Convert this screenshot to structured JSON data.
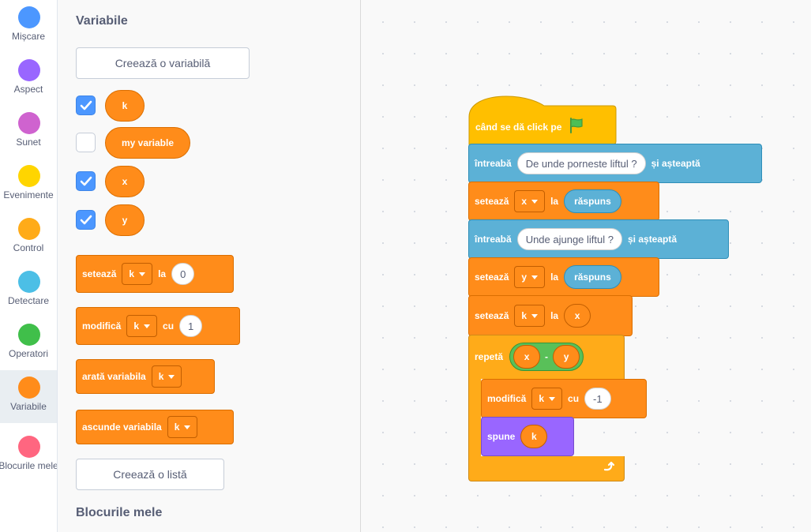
{
  "categories": [
    {
      "label": "Mișcare",
      "color": "#4c97ff",
      "icon": "motion-category-icon"
    },
    {
      "label": "Aspect",
      "color": "#9966ff",
      "icon": "looks-category-icon"
    },
    {
      "label": "Sunet",
      "color": "#cf63cf",
      "icon": "sound-category-icon"
    },
    {
      "label": "Evenimente",
      "color": "#ffd500",
      "icon": "events-category-icon"
    },
    {
      "label": "Control",
      "color": "#ffab19",
      "icon": "control-category-icon"
    },
    {
      "label": "Detectare",
      "color": "#4cbfe6",
      "icon": "sensing-category-icon"
    },
    {
      "label": "Operatori",
      "color": "#40bf4a",
      "icon": "operators-category-icon"
    },
    {
      "label": "Variabile",
      "color": "#ff8c1a",
      "icon": "variables-category-icon",
      "active": true
    },
    {
      "label": "Blocurile mele",
      "color": "#ff6680",
      "icon": "my-blocks-category-icon"
    }
  ],
  "palette": {
    "heading": "Variabile",
    "make_variable": "Creează o variabilă",
    "variables": [
      {
        "name": "k",
        "checked": true
      },
      {
        "name": "my variable",
        "checked": false
      },
      {
        "name": "x",
        "checked": true
      },
      {
        "name": "y",
        "checked": true
      }
    ],
    "set_block": {
      "label": "setează",
      "var": "k",
      "to": "la",
      "value": "0"
    },
    "change_block": {
      "label": "modifică",
      "var": "k",
      "by": "cu",
      "value": "1"
    },
    "show_block": {
      "label": "arată variabila",
      "var": "k"
    },
    "hide_block": {
      "label": "ascunde variabila",
      "var": "k"
    },
    "make_list": "Creează o listă",
    "my_blocks_heading": "Blocurile mele"
  },
  "script": {
    "hat": {
      "label": "când se dă click pe",
      "icon": "green-flag-icon"
    },
    "ask1": {
      "label": "întreabă",
      "question": "De unde porneste liftul ?",
      "wait": "și așteaptă"
    },
    "set_x": {
      "label": "setează",
      "var": "x",
      "to": "la",
      "value": "răspuns"
    },
    "ask2": {
      "label": "întreabă",
      "question": "Unde ajunge liftul ?",
      "wait": "și așteaptă"
    },
    "set_y": {
      "label": "setează",
      "var": "y",
      "to": "la",
      "value": "răspuns"
    },
    "set_k": {
      "label": "setează",
      "var": "k",
      "to": "la",
      "value": "x"
    },
    "repeat": {
      "label": "repetă",
      "left": "x",
      "op": "-",
      "right": "y",
      "icon": "loop-arrow-icon"
    },
    "change_k": {
      "label": "modifică",
      "var": "k",
      "by": "cu",
      "value": "-1"
    },
    "say": {
      "label": "spune",
      "value": "k"
    }
  },
  "colors": {
    "variables": "#ff8c1a",
    "sensing": "#5cb1d6",
    "looks": "#9966ff",
    "control": "#ffab19",
    "events": "#ffbf00",
    "operators": "#59c059"
  }
}
